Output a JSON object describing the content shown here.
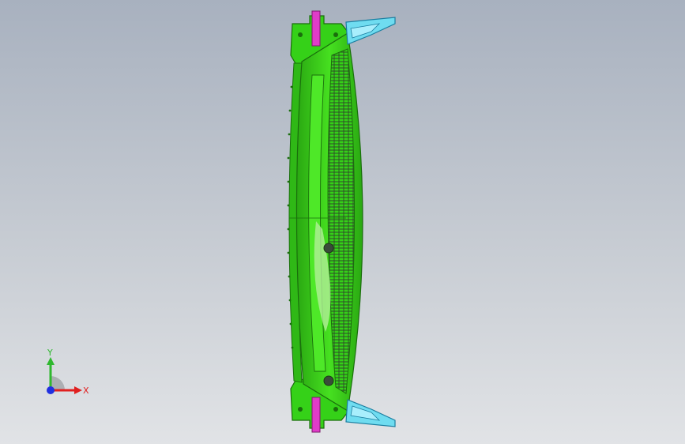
{
  "viewport": {
    "part": {
      "body_color": "#35d118",
      "edge_color": "#1a6e0c",
      "mesh_color": "#2f4a2a",
      "highlight_color": "#b9f0a0",
      "clip_color": "#6fdcf0",
      "clip_edge_color": "#1a7ea0",
      "pin_color": "#e03cc8",
      "hole_color": "#3a4a3a"
    },
    "triad": {
      "x_label": "X",
      "y_label": "Y",
      "x_color": "#e02020",
      "y_color": "#2fb82f",
      "origin_color": "#2030e0"
    }
  }
}
